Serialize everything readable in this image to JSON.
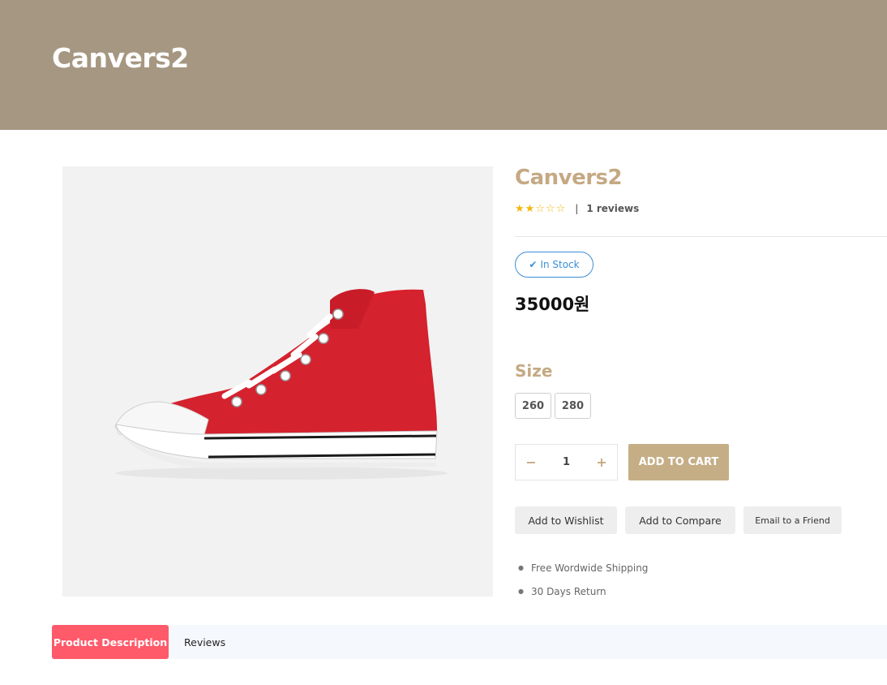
{
  "hero": {
    "title": "Canvers2"
  },
  "product": {
    "name": "Canvers2",
    "rating": 2,
    "rating_max": 5,
    "separator": "|",
    "reviews_text": "1 reviews",
    "stock_text": "In Stock",
    "price": "35000원",
    "size_label": "Size",
    "sizes": [
      "260",
      "280"
    ],
    "quantity": "1",
    "qty_minus": "−",
    "qty_plus": "+",
    "add_to_cart": "ADD TO CART",
    "actions": {
      "wishlist": "Add to Wishlist",
      "compare": "Add to Compare",
      "email": "Email to a Friend"
    },
    "perks": [
      "Free Wordwide Shipping",
      "30 Days Return"
    ]
  },
  "tabs": {
    "description": "Product Description",
    "reviews": "Reviews"
  },
  "colors": {
    "hero_bg": "#a69782",
    "accent": "#c5a983",
    "cart_button": "#c5ae86",
    "stock": "#3b8fd6",
    "star": "#f3b70b",
    "tab_active": "#ff5a6a"
  }
}
